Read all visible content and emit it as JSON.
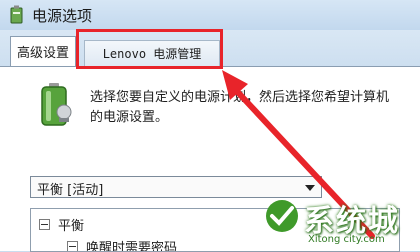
{
  "window": {
    "title": "电源选项"
  },
  "tabs": [
    {
      "label": "高级设置"
    },
    {
      "label": "Lenovo 电源管理"
    }
  ],
  "panel": {
    "description_line1": "选择您要自定义的电源计划，然后选择您希望计算机",
    "description_line2": "的电源设置。"
  },
  "plan_select": {
    "value": "平衡 [活动]"
  },
  "tree": {
    "root": "平衡",
    "child": "唤醒时需要密码"
  },
  "watermark": {
    "brand": "系统城",
    "url": "Xitong city.com"
  },
  "colors": {
    "annotation": "#e8242a",
    "watermark_green": "#2e8b1f"
  }
}
